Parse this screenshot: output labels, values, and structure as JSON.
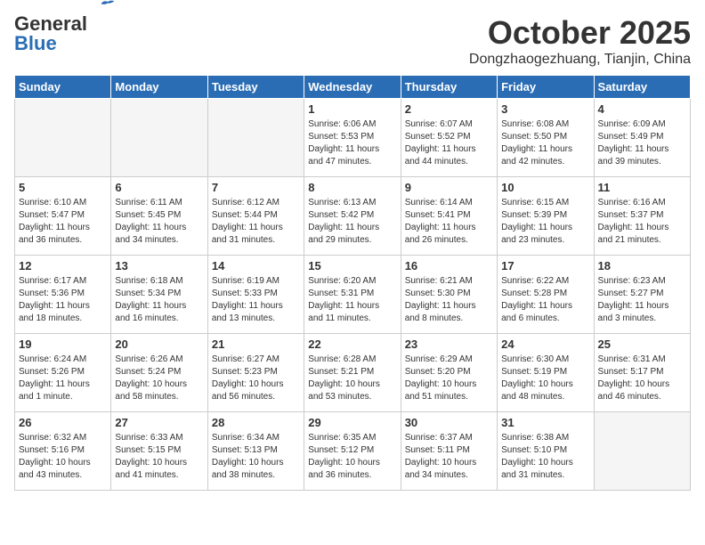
{
  "header": {
    "logo_line1": "General",
    "logo_line2": "Blue",
    "month": "October 2025",
    "location": "Dongzhaogezhuang, Tianjin, China"
  },
  "weekdays": [
    "Sunday",
    "Monday",
    "Tuesday",
    "Wednesday",
    "Thursday",
    "Friday",
    "Saturday"
  ],
  "weeks": [
    [
      {
        "day": "",
        "info": ""
      },
      {
        "day": "",
        "info": ""
      },
      {
        "day": "",
        "info": ""
      },
      {
        "day": "1",
        "info": "Sunrise: 6:06 AM\nSunset: 5:53 PM\nDaylight: 11 hours\nand 47 minutes."
      },
      {
        "day": "2",
        "info": "Sunrise: 6:07 AM\nSunset: 5:52 PM\nDaylight: 11 hours\nand 44 minutes."
      },
      {
        "day": "3",
        "info": "Sunrise: 6:08 AM\nSunset: 5:50 PM\nDaylight: 11 hours\nand 42 minutes."
      },
      {
        "day": "4",
        "info": "Sunrise: 6:09 AM\nSunset: 5:49 PM\nDaylight: 11 hours\nand 39 minutes."
      }
    ],
    [
      {
        "day": "5",
        "info": "Sunrise: 6:10 AM\nSunset: 5:47 PM\nDaylight: 11 hours\nand 36 minutes."
      },
      {
        "day": "6",
        "info": "Sunrise: 6:11 AM\nSunset: 5:45 PM\nDaylight: 11 hours\nand 34 minutes."
      },
      {
        "day": "7",
        "info": "Sunrise: 6:12 AM\nSunset: 5:44 PM\nDaylight: 11 hours\nand 31 minutes."
      },
      {
        "day": "8",
        "info": "Sunrise: 6:13 AM\nSunset: 5:42 PM\nDaylight: 11 hours\nand 29 minutes."
      },
      {
        "day": "9",
        "info": "Sunrise: 6:14 AM\nSunset: 5:41 PM\nDaylight: 11 hours\nand 26 minutes."
      },
      {
        "day": "10",
        "info": "Sunrise: 6:15 AM\nSunset: 5:39 PM\nDaylight: 11 hours\nand 23 minutes."
      },
      {
        "day": "11",
        "info": "Sunrise: 6:16 AM\nSunset: 5:37 PM\nDaylight: 11 hours\nand 21 minutes."
      }
    ],
    [
      {
        "day": "12",
        "info": "Sunrise: 6:17 AM\nSunset: 5:36 PM\nDaylight: 11 hours\nand 18 minutes."
      },
      {
        "day": "13",
        "info": "Sunrise: 6:18 AM\nSunset: 5:34 PM\nDaylight: 11 hours\nand 16 minutes."
      },
      {
        "day": "14",
        "info": "Sunrise: 6:19 AM\nSunset: 5:33 PM\nDaylight: 11 hours\nand 13 minutes."
      },
      {
        "day": "15",
        "info": "Sunrise: 6:20 AM\nSunset: 5:31 PM\nDaylight: 11 hours\nand 11 minutes."
      },
      {
        "day": "16",
        "info": "Sunrise: 6:21 AM\nSunset: 5:30 PM\nDaylight: 11 hours\nand 8 minutes."
      },
      {
        "day": "17",
        "info": "Sunrise: 6:22 AM\nSunset: 5:28 PM\nDaylight: 11 hours\nand 6 minutes."
      },
      {
        "day": "18",
        "info": "Sunrise: 6:23 AM\nSunset: 5:27 PM\nDaylight: 11 hours\nand 3 minutes."
      }
    ],
    [
      {
        "day": "19",
        "info": "Sunrise: 6:24 AM\nSunset: 5:26 PM\nDaylight: 11 hours\nand 1 minute."
      },
      {
        "day": "20",
        "info": "Sunrise: 6:26 AM\nSunset: 5:24 PM\nDaylight: 10 hours\nand 58 minutes."
      },
      {
        "day": "21",
        "info": "Sunrise: 6:27 AM\nSunset: 5:23 PM\nDaylight: 10 hours\nand 56 minutes."
      },
      {
        "day": "22",
        "info": "Sunrise: 6:28 AM\nSunset: 5:21 PM\nDaylight: 10 hours\nand 53 minutes."
      },
      {
        "day": "23",
        "info": "Sunrise: 6:29 AM\nSunset: 5:20 PM\nDaylight: 10 hours\nand 51 minutes."
      },
      {
        "day": "24",
        "info": "Sunrise: 6:30 AM\nSunset: 5:19 PM\nDaylight: 10 hours\nand 48 minutes."
      },
      {
        "day": "25",
        "info": "Sunrise: 6:31 AM\nSunset: 5:17 PM\nDaylight: 10 hours\nand 46 minutes."
      }
    ],
    [
      {
        "day": "26",
        "info": "Sunrise: 6:32 AM\nSunset: 5:16 PM\nDaylight: 10 hours\nand 43 minutes."
      },
      {
        "day": "27",
        "info": "Sunrise: 6:33 AM\nSunset: 5:15 PM\nDaylight: 10 hours\nand 41 minutes."
      },
      {
        "day": "28",
        "info": "Sunrise: 6:34 AM\nSunset: 5:13 PM\nDaylight: 10 hours\nand 38 minutes."
      },
      {
        "day": "29",
        "info": "Sunrise: 6:35 AM\nSunset: 5:12 PM\nDaylight: 10 hours\nand 36 minutes."
      },
      {
        "day": "30",
        "info": "Sunrise: 6:37 AM\nSunset: 5:11 PM\nDaylight: 10 hours\nand 34 minutes."
      },
      {
        "day": "31",
        "info": "Sunrise: 6:38 AM\nSunset: 5:10 PM\nDaylight: 10 hours\nand 31 minutes."
      },
      {
        "day": "",
        "info": ""
      }
    ]
  ]
}
